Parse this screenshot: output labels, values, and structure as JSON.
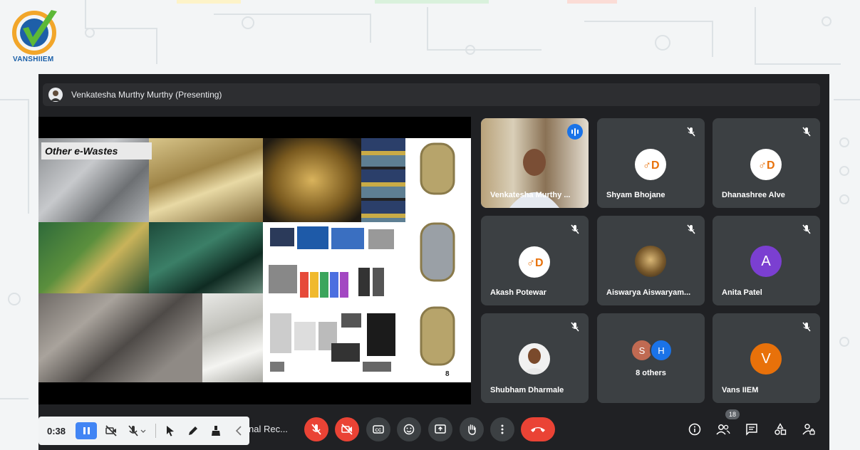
{
  "brand": {
    "logo_text": "VANSHIIEM"
  },
  "presenter_bar": {
    "label": "Venkatesha Murthy Murthy (Presenting)"
  },
  "slide": {
    "title": "Other e-Wastes",
    "page_number": "8"
  },
  "participants": [
    {
      "name": "Venkatesha Murthy ...",
      "type": "video",
      "muted": false,
      "speaking": true
    },
    {
      "name": "Shyam Bhojane",
      "type": "logo",
      "muted": true
    },
    {
      "name": "Dhanashree Alve",
      "type": "logo",
      "muted": true
    },
    {
      "name": "Akash Potewar",
      "type": "logo",
      "muted": true
    },
    {
      "name": "Aiswarya Aiswaryam...",
      "type": "photo",
      "muted": true
    },
    {
      "name": "Anita Patel",
      "type": "letter",
      "letter": "A",
      "color": "#7b3fd1",
      "muted": true
    },
    {
      "name": "Shubham Dharmale",
      "type": "photo",
      "muted": true
    },
    {
      "name": "8 others",
      "type": "group",
      "letters": [
        "S",
        "H"
      ],
      "colors": [
        "#c06a52",
        "#1a73e8"
      ]
    },
    {
      "name": "Vans IIEM",
      "type": "letter",
      "letter": "V",
      "color": "#e8710a",
      "muted": true
    }
  ],
  "recorder": {
    "time": "0:38"
  },
  "meeting": {
    "name_truncated": "nal Rec..."
  },
  "people_count": "18",
  "colors": {
    "meet_bg": "#202124",
    "tile_bg": "#3c4043",
    "danger": "#ea4335",
    "accent": "#1a73e8"
  }
}
